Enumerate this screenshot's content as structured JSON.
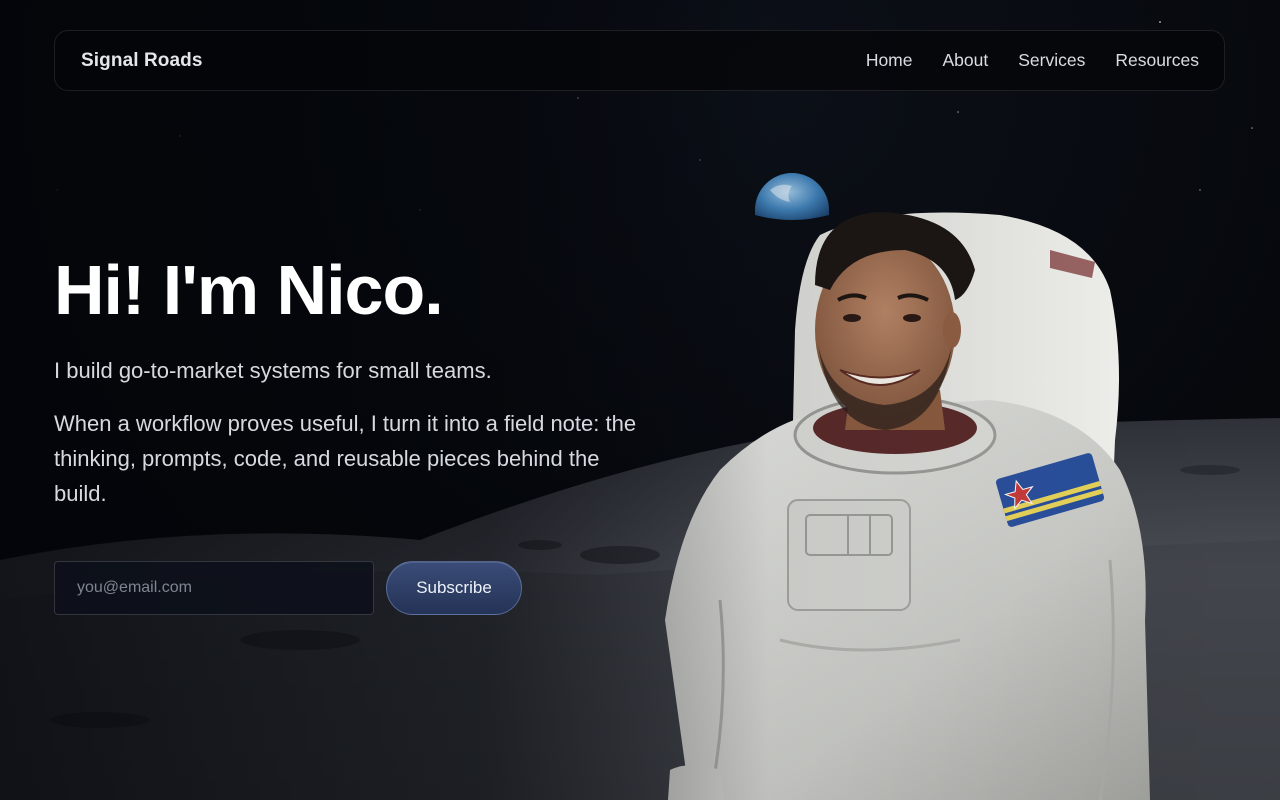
{
  "nav": {
    "brand": "Signal Roads",
    "links": [
      "Home",
      "About",
      "Services",
      "Resources"
    ]
  },
  "hero": {
    "title": "Hi! I'm Nico.",
    "tagline": "I build go-to-market systems for small teams.",
    "description": "When a workflow proves useful, I turn it into a field note: the thinking, prompts, code, and reusable pieces behind the build."
  },
  "subscribe": {
    "placeholder": "you@email.com",
    "button_label": "Subscribe"
  },
  "colors": {
    "background": "#05070b",
    "accent": "#2f3f66",
    "text": "#ffffff"
  },
  "image": {
    "subject": "astronaut-portrait",
    "earth": "earth-icon"
  }
}
